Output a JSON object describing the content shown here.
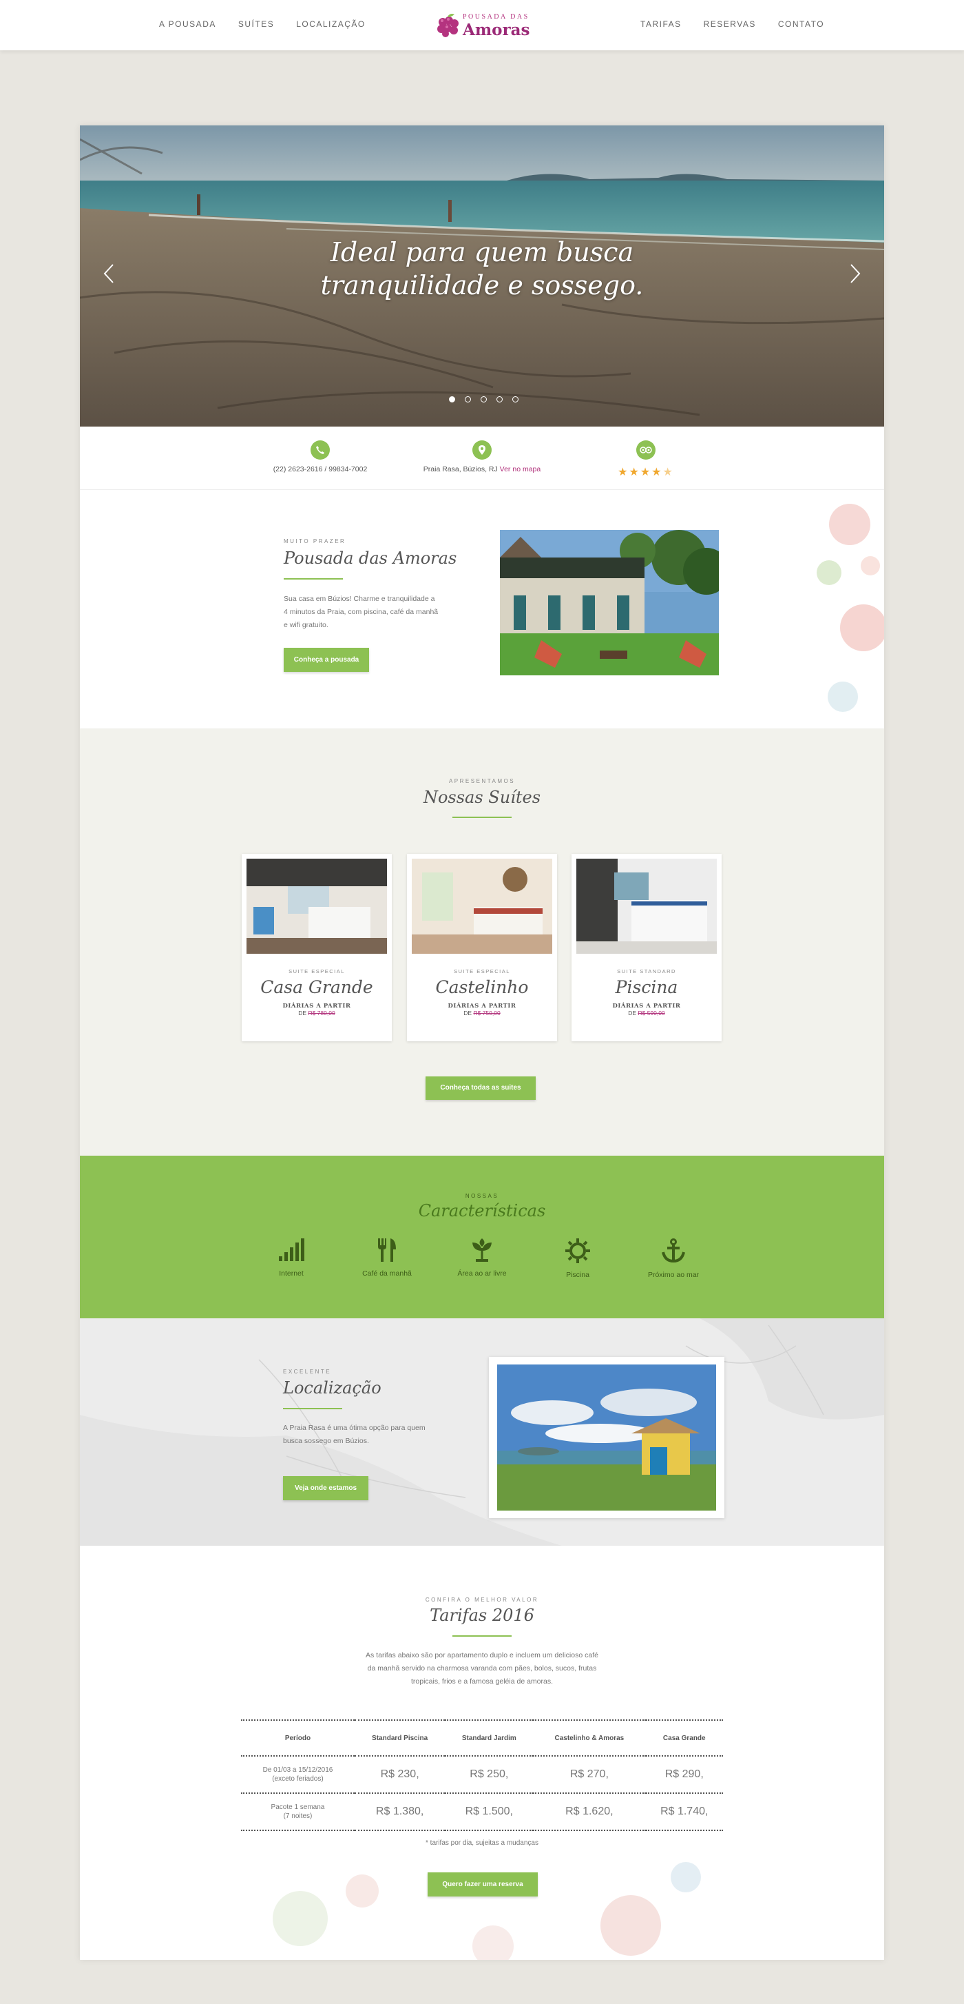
{
  "nav": {
    "left": [
      "A POUSADA",
      "SUÍTES",
      "LOCALIZAÇÃO"
    ],
    "right": [
      "TARIFAS",
      "RESERVAS",
      "CONTATO"
    ],
    "logo_top": "POUSADA DAS",
    "logo_main": "Amoras"
  },
  "hero": {
    "line1": "Ideal para quem busca",
    "line2": "tranquilidade e sossego.",
    "slides": 5,
    "active_slide": 1
  },
  "info": {
    "phone": "(22) 2623-2616 / 99834-7002",
    "address": "Praia Rasa, Búzios, RJ",
    "map_link": "Ver no mapa",
    "rating": 4.5
  },
  "about": {
    "eyebrow": "MUITO PRAZER",
    "title": "Pousada das Amoras",
    "text": "Sua casa em Búzios! Charme e tranquilidade a 4 minutos da Praia, com piscina, café da manhã e wifi gratuito.",
    "button": "Conheça a pousada"
  },
  "suites": {
    "eyebrow": "APRESENTAMOS",
    "title": "Nossas Suítes",
    "button": "Conheça todas as suites",
    "items": [
      {
        "type": "SUITE ESPECIAL",
        "name": "Casa Grande",
        "from": "DIÁRIAS A PARTIR",
        "price_prefix": "DE",
        "price": "R$ 780,00"
      },
      {
        "type": "SUITE ESPECIAL",
        "name": "Castelinho",
        "from": "DIÁRIAS A PARTIR",
        "price_prefix": "DE",
        "price": "R$ 750,00"
      },
      {
        "type": "SUITE STANDARD",
        "name": "Piscina",
        "from": "DIÁRIAS A PARTIR",
        "price_prefix": "DE",
        "price": "R$ 590,00"
      }
    ]
  },
  "features": {
    "eyebrow": "NOSSAS",
    "title": "Características",
    "items": [
      {
        "icon": "signal-icon",
        "label": "Internet"
      },
      {
        "icon": "cutlery-icon",
        "label": "Café da manhã"
      },
      {
        "icon": "plant-icon",
        "label": "Área ao ar livre"
      },
      {
        "icon": "sun-icon",
        "label": "Piscina"
      },
      {
        "icon": "anchor-icon",
        "label": "Próximo ao mar"
      }
    ]
  },
  "location": {
    "eyebrow": "EXCELENTE",
    "title": "Localização",
    "text": "A Praia Rasa é uma ótima opção para quem busca sossego em Búzios.",
    "button": "Veja onde estamos"
  },
  "rates": {
    "eyebrow": "CONFIRA O MELHOR VALOR",
    "title": "Tarifas 2016",
    "intro": "As tarifas abaixo são por apartamento duplo e incluem um delicioso café da manhã servido na charmosa varanda com pães, bolos, sucos, frutas tropicais, frios e a famosa geléia de amoras.",
    "headers": [
      "Período",
      "Standard Piscina",
      "Standard Jardim",
      "Castelinho & Amoras",
      "Casa Grande"
    ],
    "rows": [
      {
        "period_l1": "De 01/03 a 15/12/2016",
        "period_l2": "(exceto feriados)",
        "values": [
          "R$ 230,",
          "R$ 250,",
          "R$ 270,",
          "R$ 290,"
        ]
      },
      {
        "period_l1": "Pacote 1 semana",
        "period_l2": "(7 noites)",
        "values": [
          "R$ 1.380,",
          "R$ 1.500,",
          "R$ 1.620,",
          "R$ 1.740,"
        ]
      }
    ],
    "note": "* tarifas por dia, sujeitas a mudanças",
    "button": "Quero fazer  uma reserva"
  },
  "colors": {
    "accent": "#8dc153",
    "brand": "#9b2a77",
    "bg": "#e8e6e0"
  }
}
